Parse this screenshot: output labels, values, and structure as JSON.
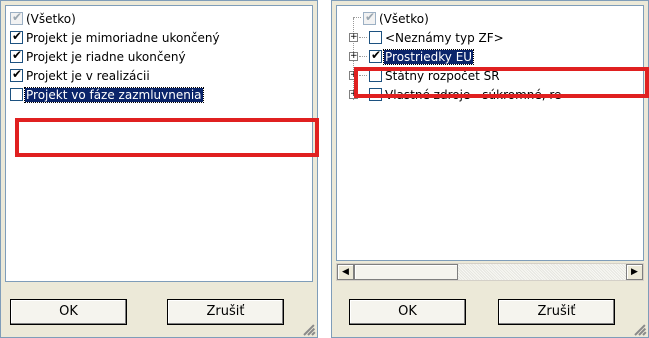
{
  "left_panel": {
    "items": [
      {
        "label": "(Všetko)",
        "checked": true,
        "greyed": true,
        "selected": false
      },
      {
        "label": "Projekt je mimoriadne ukončený",
        "checked": true,
        "greyed": false,
        "selected": false
      },
      {
        "label": "Projekt je riadne ukončený",
        "checked": true,
        "greyed": false,
        "selected": false
      },
      {
        "label": "Projekt je v realizácii",
        "checked": true,
        "greyed": false,
        "selected": false
      },
      {
        "label": "Projekt vo fáze zazmluvnenia",
        "checked": false,
        "greyed": false,
        "selected": true
      }
    ],
    "ok_label": "OK",
    "cancel_label": "Zrušiť"
  },
  "right_panel": {
    "items": [
      {
        "label": "(Všetko)",
        "checked": true,
        "greyed": true,
        "selected": false,
        "expandable": false
      },
      {
        "label": "<Neznámy typ ZF>",
        "checked": false,
        "greyed": false,
        "selected": false,
        "expandable": true
      },
      {
        "label": "Prostriedky EU",
        "checked": true,
        "greyed": false,
        "selected": true,
        "expandable": true
      },
      {
        "label": "Štátny rozpočet SR",
        "checked": false,
        "greyed": false,
        "selected": false,
        "expandable": true
      },
      {
        "label": "Vlastné zdroje - súkromné, re",
        "checked": false,
        "greyed": false,
        "selected": false,
        "expandable": true
      }
    ],
    "ok_label": "OK",
    "cancel_label": "Zrušiť"
  },
  "colors": {
    "highlight": "#e02020",
    "selection": "#0a246a"
  }
}
